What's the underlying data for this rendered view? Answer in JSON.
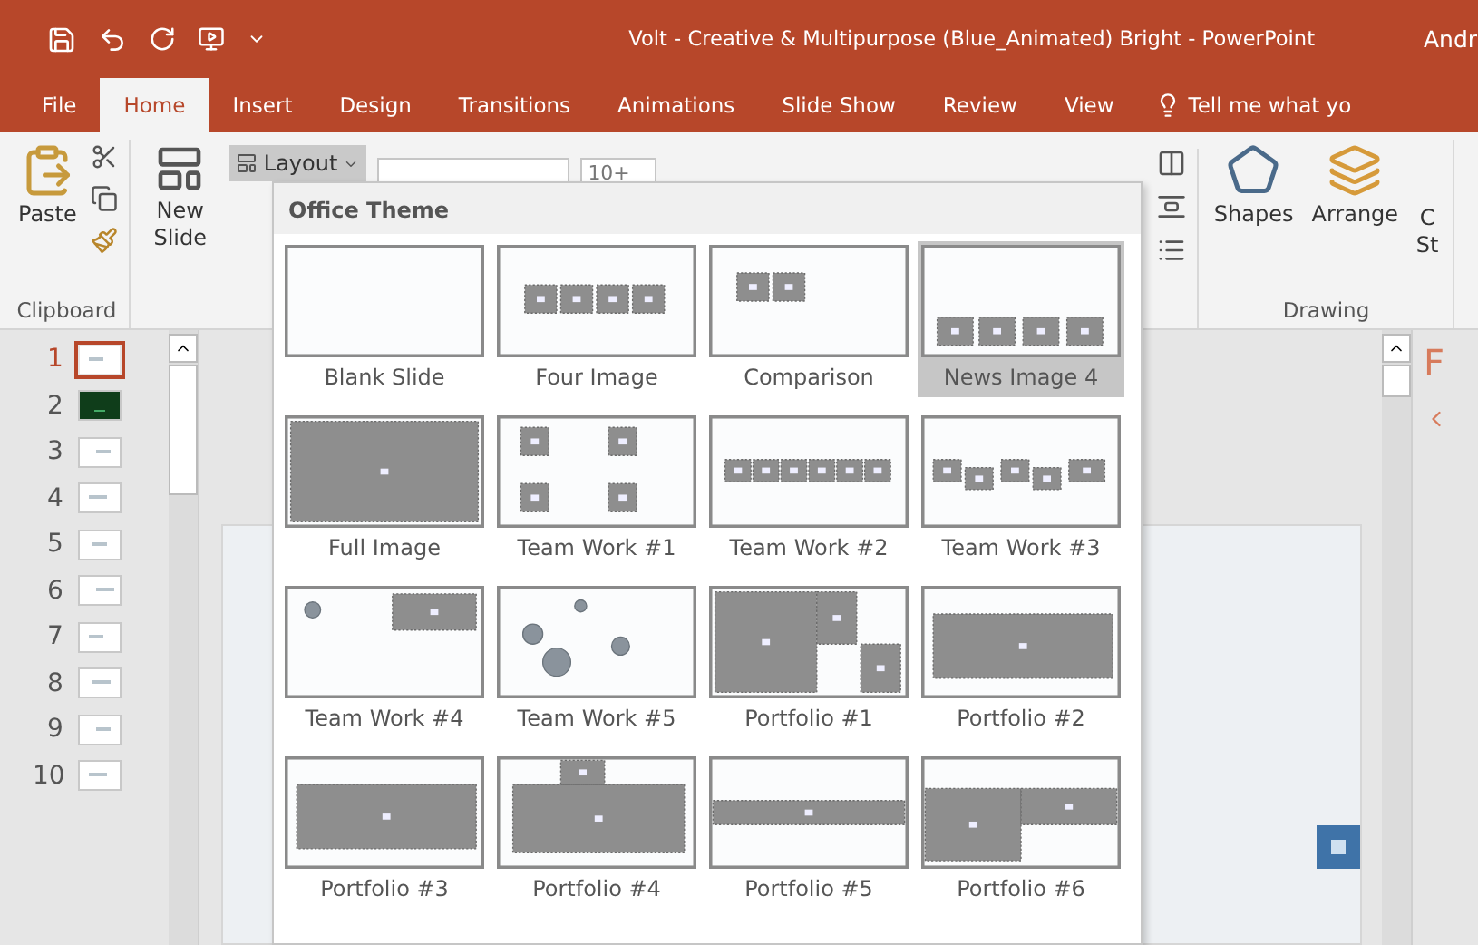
{
  "window": {
    "title": "Volt - Creative & Multipurpose (Blue_Animated) Bright  -  PowerPoint",
    "user": "Andr"
  },
  "tabs": [
    {
      "label": "File",
      "selected": false
    },
    {
      "label": "Home",
      "selected": true
    },
    {
      "label": "Insert",
      "selected": false
    },
    {
      "label": "Design",
      "selected": false
    },
    {
      "label": "Transitions",
      "selected": false
    },
    {
      "label": "Animations",
      "selected": false
    },
    {
      "label": "Slide Show",
      "selected": false
    },
    {
      "label": "Review",
      "selected": false
    },
    {
      "label": "View",
      "selected": false
    }
  ],
  "tell_me": {
    "label": "Tell me what yo"
  },
  "ribbon": {
    "paste": "Paste",
    "clipboard_group": "Clipboard",
    "new_slide": "New Slide",
    "layout": "Layout",
    "font_size": "10+",
    "shapes": "Shapes",
    "arrange": "Arrange",
    "quick_styles": "C",
    "quick_styles_line2": "St",
    "drawing_group": "Drawing"
  },
  "slides": [
    {
      "number": "1",
      "selected": true
    },
    {
      "number": "2",
      "selected": false
    },
    {
      "number": "3",
      "selected": false
    },
    {
      "number": "4",
      "selected": false
    },
    {
      "number": "5",
      "selected": false
    },
    {
      "number": "6",
      "selected": false
    },
    {
      "number": "7",
      "selected": false
    },
    {
      "number": "8",
      "selected": false
    },
    {
      "number": "9",
      "selected": false
    },
    {
      "number": "10",
      "selected": false
    }
  ],
  "layout_gallery": {
    "header": "Office Theme",
    "items": [
      {
        "label": "Blank Slide",
        "selected": false
      },
      {
        "label": "Four Image",
        "selected": false
      },
      {
        "label": "Comparison",
        "selected": false
      },
      {
        "label": "News Image 4",
        "selected": true
      },
      {
        "label": "Full Image",
        "selected": false
      },
      {
        "label": "Team Work #1",
        "selected": false
      },
      {
        "label": "Team Work #2",
        "selected": false
      },
      {
        "label": "Team Work #3",
        "selected": false
      },
      {
        "label": "Team Work #4",
        "selected": false
      },
      {
        "label": "Team Work #5",
        "selected": false
      },
      {
        "label": "Portfolio #1",
        "selected": false
      },
      {
        "label": "Portfolio #2",
        "selected": false
      },
      {
        "label": "Portfolio #3",
        "selected": false
      },
      {
        "label": "Portfolio #4",
        "selected": false
      },
      {
        "label": "Portfolio #5",
        "selected": false
      },
      {
        "label": "Portfolio #6",
        "selected": false
      }
    ]
  },
  "task_pane": {
    "title": "F"
  }
}
